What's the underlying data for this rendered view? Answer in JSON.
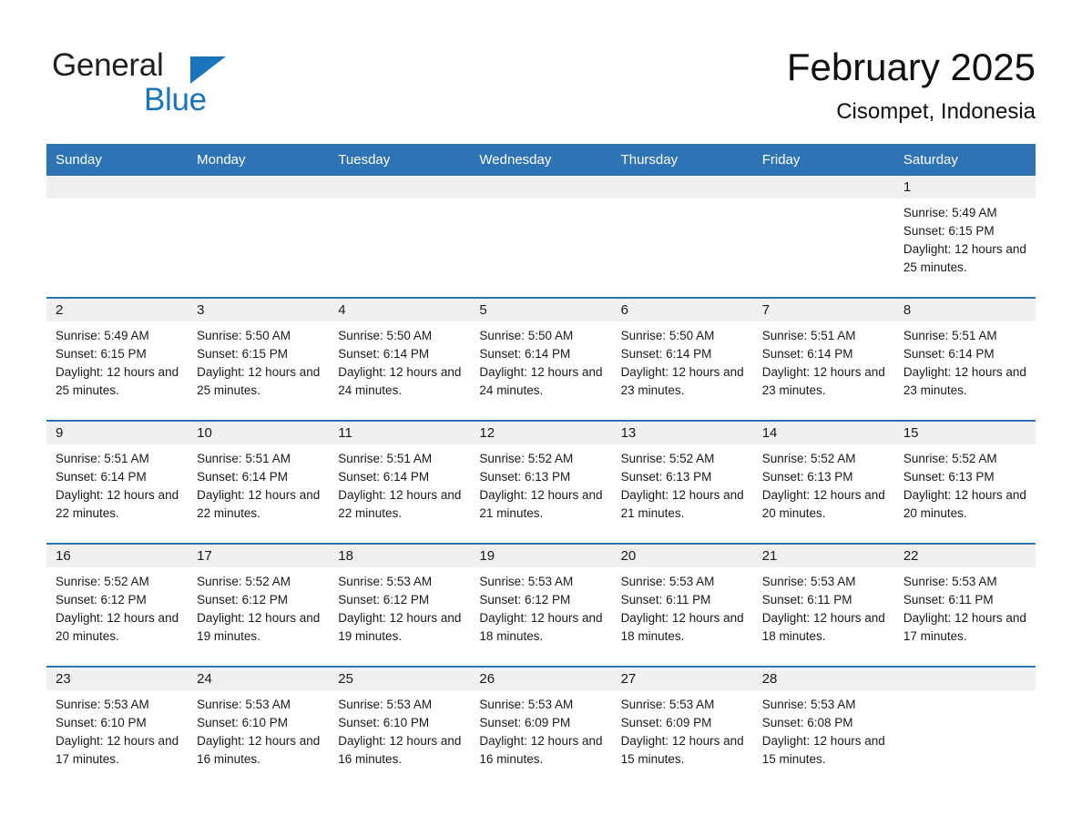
{
  "brand": {
    "line1": "General",
    "line2": "Blue",
    "triangle_color": "#1b75bb"
  },
  "header": {
    "month_title": "February 2025",
    "location": "Cisompet, Indonesia",
    "accent_color": "#2e74b5",
    "band_color": "#f0f0f0"
  },
  "calendar": {
    "weekday_headers": [
      "Sunday",
      "Monday",
      "Tuesday",
      "Wednesday",
      "Thursday",
      "Friday",
      "Saturday"
    ],
    "weeks": [
      [
        {
          "day": "",
          "empty": true
        },
        {
          "day": "",
          "empty": true
        },
        {
          "day": "",
          "empty": true
        },
        {
          "day": "",
          "empty": true
        },
        {
          "day": "",
          "empty": true
        },
        {
          "day": "",
          "empty": true
        },
        {
          "day": "1",
          "sunrise": "Sunrise: 5:49 AM",
          "sunset": "Sunset: 6:15 PM",
          "daylight": "Daylight: 12 hours and 25 minutes."
        }
      ],
      [
        {
          "day": "2",
          "sunrise": "Sunrise: 5:49 AM",
          "sunset": "Sunset: 6:15 PM",
          "daylight": "Daylight: 12 hours and 25 minutes."
        },
        {
          "day": "3",
          "sunrise": "Sunrise: 5:50 AM",
          "sunset": "Sunset: 6:15 PM",
          "daylight": "Daylight: 12 hours and 25 minutes."
        },
        {
          "day": "4",
          "sunrise": "Sunrise: 5:50 AM",
          "sunset": "Sunset: 6:14 PM",
          "daylight": "Daylight: 12 hours and 24 minutes."
        },
        {
          "day": "5",
          "sunrise": "Sunrise: 5:50 AM",
          "sunset": "Sunset: 6:14 PM",
          "daylight": "Daylight: 12 hours and 24 minutes."
        },
        {
          "day": "6",
          "sunrise": "Sunrise: 5:50 AM",
          "sunset": "Sunset: 6:14 PM",
          "daylight": "Daylight: 12 hours and 23 minutes."
        },
        {
          "day": "7",
          "sunrise": "Sunrise: 5:51 AM",
          "sunset": "Sunset: 6:14 PM",
          "daylight": "Daylight: 12 hours and 23 minutes."
        },
        {
          "day": "8",
          "sunrise": "Sunrise: 5:51 AM",
          "sunset": "Sunset: 6:14 PM",
          "daylight": "Daylight: 12 hours and 23 minutes."
        }
      ],
      [
        {
          "day": "9",
          "sunrise": "Sunrise: 5:51 AM",
          "sunset": "Sunset: 6:14 PM",
          "daylight": "Daylight: 12 hours and 22 minutes."
        },
        {
          "day": "10",
          "sunrise": "Sunrise: 5:51 AM",
          "sunset": "Sunset: 6:14 PM",
          "daylight": "Daylight: 12 hours and 22 minutes."
        },
        {
          "day": "11",
          "sunrise": "Sunrise: 5:51 AM",
          "sunset": "Sunset: 6:14 PM",
          "daylight": "Daylight: 12 hours and 22 minutes."
        },
        {
          "day": "12",
          "sunrise": "Sunrise: 5:52 AM",
          "sunset": "Sunset: 6:13 PM",
          "daylight": "Daylight: 12 hours and 21 minutes."
        },
        {
          "day": "13",
          "sunrise": "Sunrise: 5:52 AM",
          "sunset": "Sunset: 6:13 PM",
          "daylight": "Daylight: 12 hours and 21 minutes."
        },
        {
          "day": "14",
          "sunrise": "Sunrise: 5:52 AM",
          "sunset": "Sunset: 6:13 PM",
          "daylight": "Daylight: 12 hours and 20 minutes."
        },
        {
          "day": "15",
          "sunrise": "Sunrise: 5:52 AM",
          "sunset": "Sunset: 6:13 PM",
          "daylight": "Daylight: 12 hours and 20 minutes."
        }
      ],
      [
        {
          "day": "16",
          "sunrise": "Sunrise: 5:52 AM",
          "sunset": "Sunset: 6:12 PM",
          "daylight": "Daylight: 12 hours and 20 minutes."
        },
        {
          "day": "17",
          "sunrise": "Sunrise: 5:52 AM",
          "sunset": "Sunset: 6:12 PM",
          "daylight": "Daylight: 12 hours and 19 minutes."
        },
        {
          "day": "18",
          "sunrise": "Sunrise: 5:53 AM",
          "sunset": "Sunset: 6:12 PM",
          "daylight": "Daylight: 12 hours and 19 minutes."
        },
        {
          "day": "19",
          "sunrise": "Sunrise: 5:53 AM",
          "sunset": "Sunset: 6:12 PM",
          "daylight": "Daylight: 12 hours and 18 minutes."
        },
        {
          "day": "20",
          "sunrise": "Sunrise: 5:53 AM",
          "sunset": "Sunset: 6:11 PM",
          "daylight": "Daylight: 12 hours and 18 minutes."
        },
        {
          "day": "21",
          "sunrise": "Sunrise: 5:53 AM",
          "sunset": "Sunset: 6:11 PM",
          "daylight": "Daylight: 12 hours and 18 minutes."
        },
        {
          "day": "22",
          "sunrise": "Sunrise: 5:53 AM",
          "sunset": "Sunset: 6:11 PM",
          "daylight": "Daylight: 12 hours and 17 minutes."
        }
      ],
      [
        {
          "day": "23",
          "sunrise": "Sunrise: 5:53 AM",
          "sunset": "Sunset: 6:10 PM",
          "daylight": "Daylight: 12 hours and 17 minutes."
        },
        {
          "day": "24",
          "sunrise": "Sunrise: 5:53 AM",
          "sunset": "Sunset: 6:10 PM",
          "daylight": "Daylight: 12 hours and 16 minutes."
        },
        {
          "day": "25",
          "sunrise": "Sunrise: 5:53 AM",
          "sunset": "Sunset: 6:10 PM",
          "daylight": "Daylight: 12 hours and 16 minutes."
        },
        {
          "day": "26",
          "sunrise": "Sunrise: 5:53 AM",
          "sunset": "Sunset: 6:09 PM",
          "daylight": "Daylight: 12 hours and 16 minutes."
        },
        {
          "day": "27",
          "sunrise": "Sunrise: 5:53 AM",
          "sunset": "Sunset: 6:09 PM",
          "daylight": "Daylight: 12 hours and 15 minutes."
        },
        {
          "day": "28",
          "sunrise": "Sunrise: 5:53 AM",
          "sunset": "Sunset: 6:08 PM",
          "daylight": "Daylight: 12 hours and 15 minutes."
        },
        {
          "day": "",
          "empty": true
        }
      ]
    ]
  }
}
